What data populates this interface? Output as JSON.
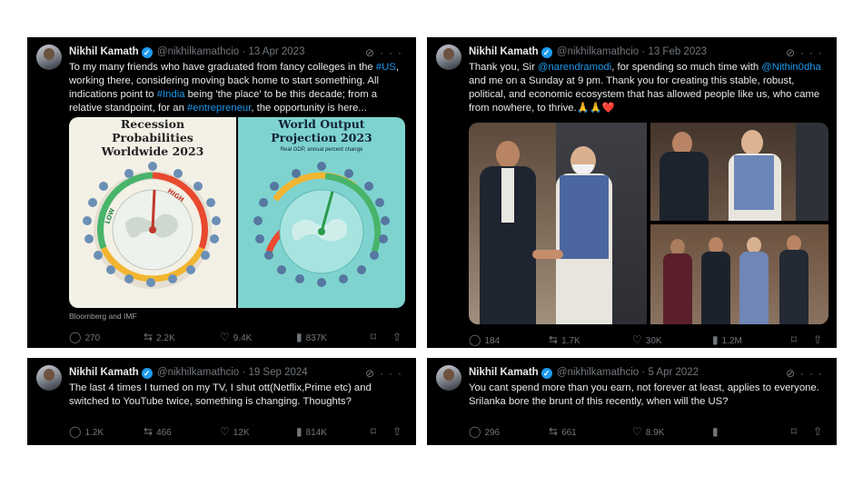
{
  "tweets": [
    {
      "author": "Nikhil Kamath",
      "handle": "@nikhilkamathcio",
      "sep": "·",
      "date": "13 Apr 2023",
      "text_parts": [
        "To my many friends who have graduated from fancy colleges in the ",
        "#US",
        ", working there, considering moving back home to start something. All indications point to ",
        "#India",
        " being 'the place' to be this decade; from a relative standpoint, for an ",
        "#entrepreneur",
        ", the opportunity is here..."
      ],
      "image_left_title": "Recession Probabilities Worldwide 2023",
      "image_right_title": "World Output Projection 2023",
      "image_right_subtitle": "Real GDP, annual percent change",
      "image_left_gauge": {
        "high": "HIGH",
        "low": "LOW"
      },
      "source": "Bloomberg and IMF",
      "stats": {
        "replies": "270",
        "retweets": "2.2K",
        "likes": "9.4K",
        "views": "837K"
      }
    },
    {
      "author": "Nikhil Kamath",
      "handle": "@nikhilkamathcio",
      "sep": "·",
      "date": "13 Feb 2023",
      "text_parts": [
        "Thank you, Sir ",
        "@narendramodi",
        ", for spending so much time with ",
        "@Nithin0dha",
        " and me on a Sunday at 9 pm. Thank you for creating this stable, robust, political, and economic ecosystem that has allowed people like us, who came from nowhere, to thrive.🙏🙏❤️"
      ],
      "stats": {
        "replies": "184",
        "retweets": "1.7K",
        "likes": "30K",
        "views": "1.2M"
      }
    },
    {
      "author": "Nikhil Kamath",
      "handle": "@nikhilkamathcio",
      "sep": "·",
      "date": "19 Sep 2024",
      "text": "The last 4 times I turned on my TV, I shut ott(Netflix,Prime etc) and switched to YouTube twice, something is changing. Thoughts?",
      "stats": {
        "replies": "1.2K",
        "retweets": "466",
        "likes": "12K",
        "views": "814K"
      }
    },
    {
      "author": "Nikhil Kamath",
      "handle": "@nikhilkamathcio",
      "sep": "·",
      "date": "5 Apr 2022",
      "text": "You cant spend more than you earn, not forever at least, applies to everyone. Srilanka bore the brunt of this recently, when will the US?",
      "stats": {
        "replies": "296",
        "retweets": "661",
        "likes": "8.9K"
      }
    }
  ],
  "colors": {
    "accent": "#1d9bf0",
    "muted": "#71767b",
    "text": "#e7e9ea",
    "card": "#000000",
    "like": "#f91880"
  },
  "icons": [
    "verified-badge-icon",
    "grok-icon",
    "more-icon",
    "reply-icon",
    "retweet-icon",
    "like-icon",
    "views-icon",
    "bookmark-icon",
    "share-icon"
  ]
}
